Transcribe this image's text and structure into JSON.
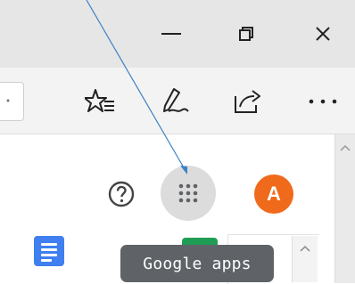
{
  "window_controls": {
    "minimize_icon": "minimize-icon",
    "restore_icon": "restore-icon",
    "close_icon": "close-icon"
  },
  "toolbar": {
    "favorites_icon": "favorites-star-icon",
    "notes_icon": "web-notes-pen-icon",
    "share_icon": "share-icon",
    "more_icon": "more-ellipsis-icon"
  },
  "header": {
    "help_icon": "help-circle-icon",
    "apps_icon": "apps-grid-icon",
    "avatar_letter": "A"
  },
  "tooltip": {
    "text": "Google apps"
  },
  "colors": {
    "titlebar": "#e6e6e6",
    "toolbar": "#f3f3f3",
    "apps_button_bg": "#dcdcdc",
    "avatar_bg": "#f06a1b",
    "tooltip_bg": "#5f6368",
    "annotation_arrow": "#3b82c4",
    "docs_icon": "#3f7ff0",
    "sheets_icon": "#1f9d55"
  }
}
